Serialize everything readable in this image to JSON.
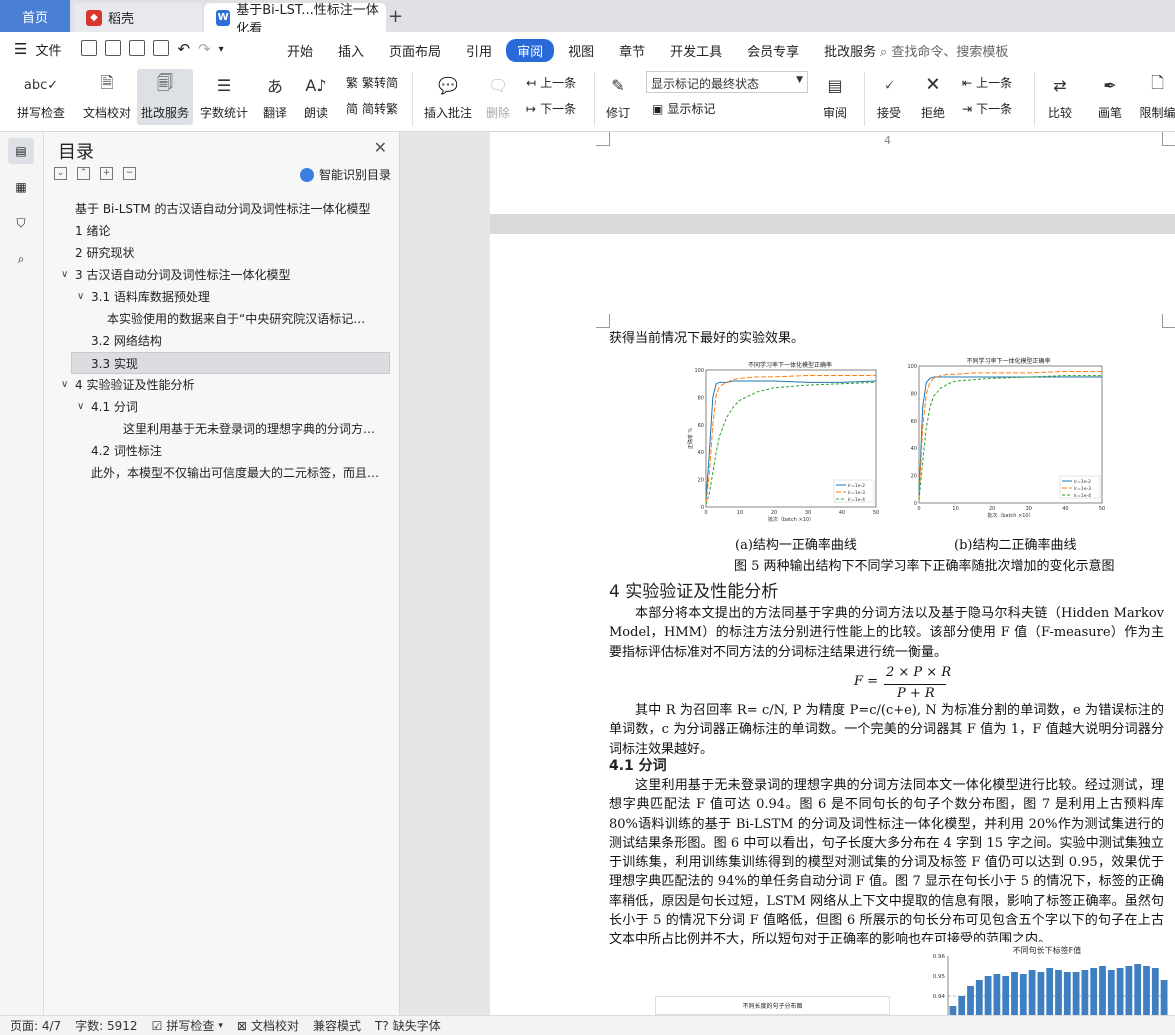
{
  "tabs": {
    "home": "首页",
    "straw": "稻壳",
    "doc": "基于Bi-LST...性标注一体化看"
  },
  "menu": {
    "file": "文件",
    "tabs": [
      "开始",
      "插入",
      "页面布局",
      "引用",
      "审阅",
      "视图",
      "章节",
      "开发工具",
      "会员专享",
      "批改服务"
    ],
    "active_tab": "审阅",
    "search": "查找命令、搜索模板"
  },
  "ribbon": {
    "spell_check": "拼写检查",
    "doc_proof": "文档校对",
    "correction_service": "批改服务",
    "word_count": "字数统计",
    "translate": "翻译",
    "read_aloud": "朗读",
    "trad_to_simp": "繁转简",
    "simp_to_trad": "简转繁",
    "insert_comment": "插入批注",
    "delete": "删除",
    "prev": "上一条",
    "next": "下一条",
    "revise": "修订",
    "markup_state": "显示标记的最终状态",
    "show_markup": "显示标记",
    "review": "审阅",
    "accept": "接受",
    "reject": "拒绝",
    "prev2": "上一条",
    "next2": "下一条",
    "compare": "比较",
    "pen": "画笔",
    "restrict": "限制编"
  },
  "toc": {
    "title": "目录",
    "smart": "智能识别目录",
    "items": [
      "基于 Bi-LSTM 的古汉语自动分词及词性标注一体化模型",
      "1   绪论",
      "2   研究现状",
      "3  古汉语自动分词及词性标注一体化模型",
      "3.1 语料库数据预处理",
      "本实验使用的数据来自于“中央研究院汉语标记…",
      "3.2 网络结构",
      "3.3  实现",
      "4 实验验证及性能分析",
      "4.1 分词",
      "这里利用基于无未登录词的理想字典的分词方…",
      "4.2 词性标注",
      "此外，本模型不仅输出可信度最大的二元标签，而且…"
    ]
  },
  "doc": {
    "page_number": "4",
    "line1": "获得当前情况下最好的实验效果。",
    "chart1_title": "不同学习率下一体化模型正确率",
    "chart2_title": "不同学习率下一体化模型正确率",
    "chart_ylabel": "正确率 %",
    "chart_xlabel": "批次（batch ×10）",
    "legend": [
      "lr=1e-2",
      "lr=1e-3",
      "lr=1e-4"
    ],
    "sub_a": "(a)结构一正确率曲线",
    "sub_b": "(b)结构二正确率曲线",
    "fig5": "图 5 两种输出结构下不同学习率下正确率随批次增加的变化示意图",
    "h4": "4 实验验证及性能分析",
    "p1": "本部分将本文提出的方法同基于字典的分词方法以及基于隐马尔科夫链（Hidden Markov Model，HMM）的标注方法分别进行性能上的比较。该部分使用 F 值（F-measure）作为主要指标评估标准对不同方法的分词标注结果进行统一衡量。",
    "formula_lhs": "F =",
    "formula_num": "2 × P × R",
    "formula_den": "P + R",
    "p2": "其中 R 为召回率 R= c/N, P 为精度 P=c/(c+e), N 为标准分割的单词数，e 为错误标注的单词数，c 为分词器正确标注的单词数。一个完美的分词器其 F 值为 1，F 值越大说明分词器分词标注效果越好。",
    "h41": "4.1 分词",
    "p3": "这里利用基于无未登录词的理想字典的分词方法同本文一体化模型进行比较。经过测试，理想字典匹配法 F 值可达 0.94。图 6 是不同句长的句子个数分布图，图 7 是利用上古预料库 80%语料训练的基于 Bi-LSTM 的分词及词性标注一体化模型，并利用 20%作为测试集进行的测试结果条形图。图 6 中可以看出，句子长度大多分布在 4 字到 15 字之间。实验中测试集独立于训练集，利用训练集训练得到的模型对测试集的分词及标签 F 值仍可以达到 0.95，效果优于理想字典匹配法的 94%的单任务自动分词 F 值。图 7 显示在句长小于 5 的情况下，标签的正确率稍低，原因是句长过短，LSTM 网络从上下文中提取的信息有限，影响了标签正确率。虽然句长小于 5 的情况下分词 F 值略低，但图 6 所展示的句长分布可见包含五个字以下的句子在上古文本中所占比例并不大，所以短句对于正确率的影响也在可接受的范围之内。",
    "chart3_title": "不同句长下标签F值",
    "chart3_yticks": [
      "0.96",
      "0.95",
      "0.94"
    ],
    "chart4_title": "不同长度的句子分布图"
  },
  "status": {
    "page": "页面: 4/7",
    "words": "字数: 5912",
    "spell": "拼写检查",
    "proof": "文档校对",
    "compat": "兼容模式",
    "missing_font": "缺失字体"
  },
  "chart_data": [
    {
      "type": "line",
      "title": "不同学习率下一体化模型正确率",
      "xlabel": "批次（batch ×10）",
      "ylabel": "正确率 %",
      "xlim": [
        0,
        50
      ],
      "ylim": [
        0,
        100
      ],
      "x": [
        0,
        1,
        2,
        3,
        4,
        6,
        8,
        10,
        15,
        20,
        30,
        40,
        50
      ],
      "series": [
        {
          "name": "lr=1e-2",
          "values": [
            5,
            40,
            80,
            90,
            91,
            91,
            92,
            92,
            92,
            92,
            91,
            91,
            92
          ]
        },
        {
          "name": "lr=1e-3",
          "values": [
            3,
            25,
            60,
            82,
            88,
            91,
            93,
            94,
            95,
            95,
            96,
            96,
            96
          ]
        },
        {
          "name": "lr=1e-4",
          "values": [
            2,
            10,
            25,
            40,
            52,
            65,
            73,
            78,
            84,
            87,
            89,
            90,
            91
          ]
        }
      ]
    },
    {
      "type": "line",
      "title": "不同学习率下一体化模型正确率",
      "xlabel": "批次（batch ×10）",
      "ylabel": "正确率 %",
      "xlim": [
        0,
        50
      ],
      "ylim": [
        0,
        100
      ],
      "x": [
        0,
        1,
        2,
        3,
        4,
        6,
        8,
        10,
        15,
        20,
        30,
        40,
        50
      ],
      "series": [
        {
          "name": "lr=1e-2",
          "values": [
            5,
            70,
            88,
            91,
            92,
            92,
            92,
            92,
            92,
            92,
            92,
            92,
            92
          ]
        },
        {
          "name": "lr=1e-3",
          "values": [
            3,
            55,
            80,
            88,
            91,
            93,
            94,
            94,
            95,
            95,
            95,
            96,
            96
          ]
        },
        {
          "name": "lr=1e-4",
          "values": [
            2,
            30,
            55,
            70,
            78,
            84,
            87,
            89,
            90,
            91,
            92,
            93,
            93
          ]
        }
      ]
    },
    {
      "type": "bar",
      "title": "不同句长下标签F值",
      "ylim": [
        0.93,
        0.96
      ],
      "values": [
        0.935,
        0.94,
        0.945,
        0.948,
        0.95,
        0.951,
        0.95,
        0.952,
        0.951,
        0.953,
        0.952,
        0.954,
        0.953,
        0.952,
        0.952,
        0.953,
        0.954,
        0.955,
        0.953,
        0.954,
        0.955,
        0.956,
        0.955,
        0.954,
        0.948
      ]
    }
  ]
}
